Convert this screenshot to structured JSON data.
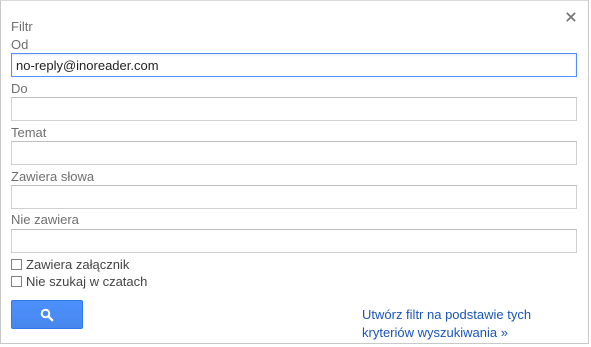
{
  "dialog": {
    "title": "Filtr",
    "close_icon": "close-icon",
    "fields": [
      {
        "label": "Od",
        "value": "no-reply@inoreader.com",
        "placeholder": ""
      },
      {
        "label": "Do",
        "value": "",
        "placeholder": ""
      },
      {
        "label": "Temat",
        "value": "",
        "placeholder": ""
      },
      {
        "label": "Zawiera słowa",
        "value": "",
        "placeholder": ""
      },
      {
        "label": "Nie zawiera",
        "value": "",
        "placeholder": ""
      }
    ],
    "checkboxes": [
      {
        "label": "Zawiera załącznik",
        "checked": false
      },
      {
        "label": "Nie szukaj w czatach",
        "checked": false
      }
    ],
    "search_button_icon": "search-icon",
    "create_filter_link": "Utwórz filtr na podstawie tych kryteriów wyszukiwania »"
  },
  "colors": {
    "accent": "#4d90fe",
    "link": "#1a55b9",
    "label": "#6f6f6f"
  }
}
